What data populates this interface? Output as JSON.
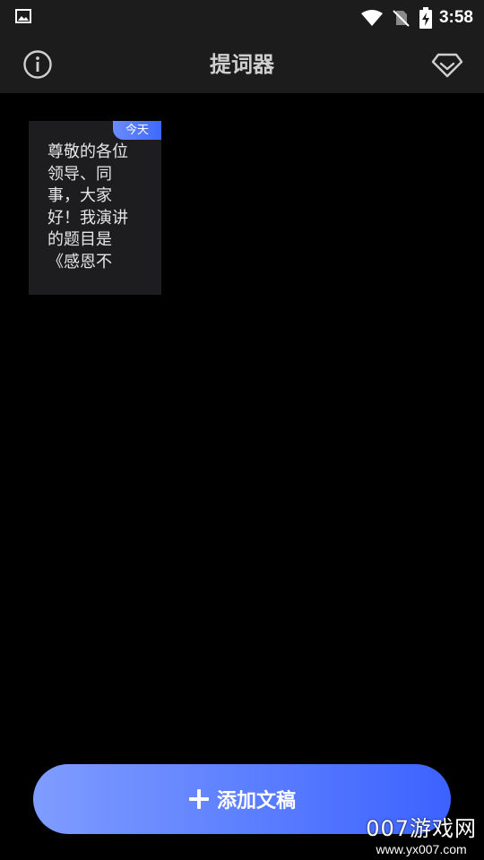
{
  "status_bar": {
    "time": "3:58",
    "icons": [
      "gallery-notification-icon",
      "wifi-icon",
      "no-sim-icon",
      "battery-charging-icon"
    ]
  },
  "toolbar": {
    "title": "提词器",
    "left_icon": "info-icon",
    "right_icon": "diamond-vip-icon"
  },
  "documents": [
    {
      "date_badge": "今天",
      "preview": "尊敬的各位领导、同事，大家好！我演讲的题目是《感恩不忘，扶助前行》"
    }
  ],
  "add_button": {
    "label": "添加文稿",
    "icon": "plus-icon"
  },
  "watermark": {
    "main": "007游戏网",
    "sub": "www.yx007.com"
  },
  "colors": {
    "background": "#000000",
    "bar": "#1c1c1c",
    "card": "#1d1d1f",
    "accent_start": "#7f9cff",
    "accent_end": "#3c62ff"
  }
}
